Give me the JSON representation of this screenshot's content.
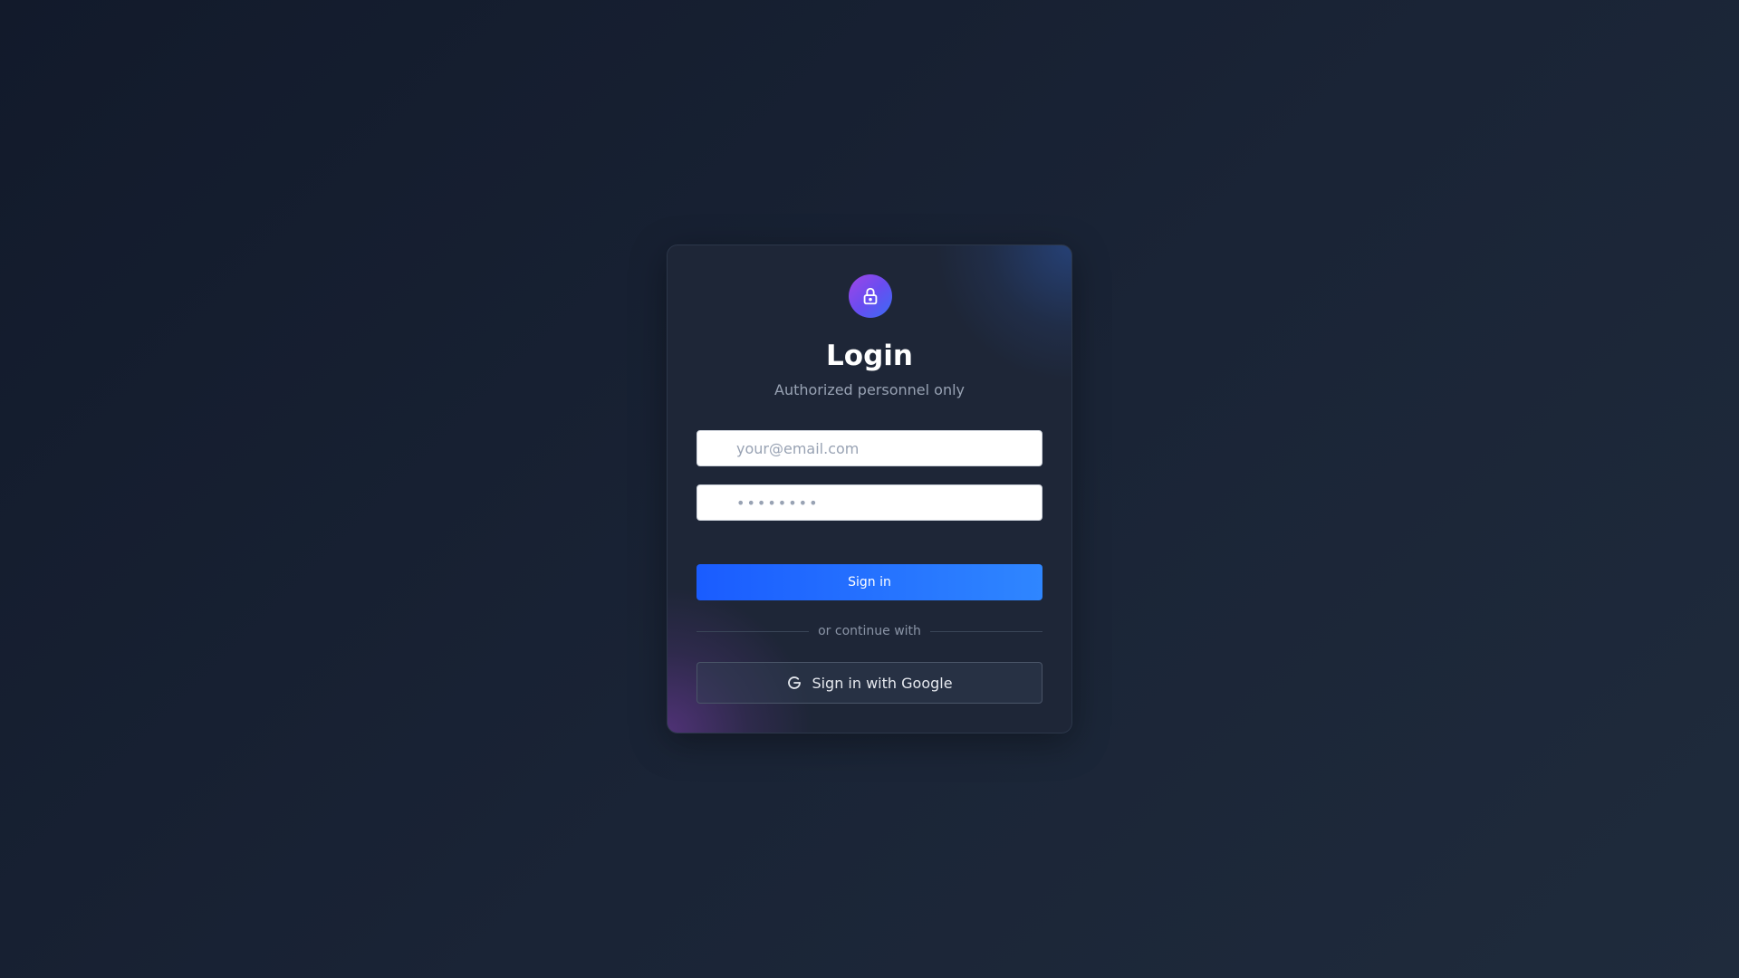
{
  "header": {
    "title": "Login",
    "subtitle": "Authorized personnel only",
    "logo_icon": "lock-icon"
  },
  "form": {
    "email_placeholder": "your@email.com",
    "password_placeholder": "••••••••",
    "submit_label": "Sign in"
  },
  "divider": {
    "text": "or continue with"
  },
  "social": {
    "google_label": "Sign in with Google",
    "google_icon": "google-icon"
  },
  "colors": {
    "primary": "#1a5cff",
    "logo_gradient_start": "#a046e6",
    "logo_gradient_end": "#3a6cf5"
  }
}
